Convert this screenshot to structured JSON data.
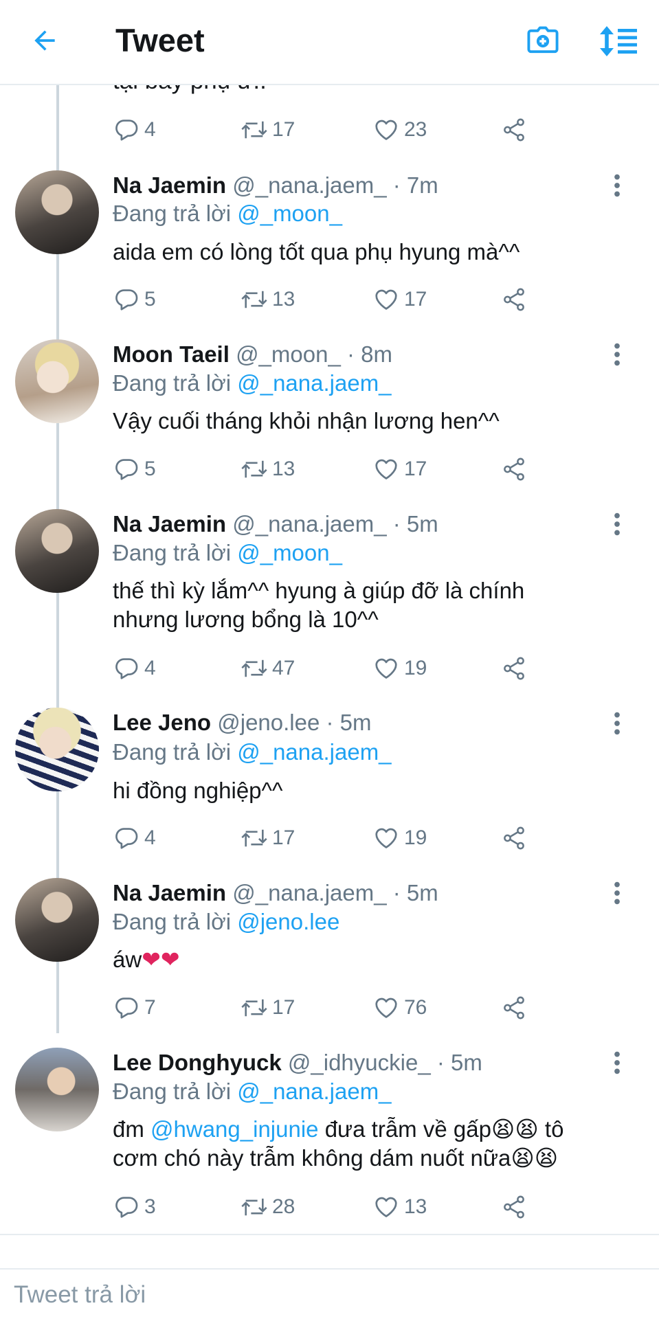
{
  "header": {
    "title": "Tweet"
  },
  "partial_tweet": {
    "text": "tại bây phụ ư..",
    "stats": {
      "replies": "4",
      "retweets": "17",
      "likes": "23"
    }
  },
  "replying_label": "Đang trả lời",
  "tweets": [
    {
      "name": "Na Jaemin",
      "handle": "@_nana.jaem_",
      "time": "· 7m",
      "replying_to": "@_moon_",
      "text": "aida em có lòng tốt qua phụ hyung mà^^",
      "stats": {
        "replies": "5",
        "retweets": "13",
        "likes": "17"
      }
    },
    {
      "name": "Moon Taeil",
      "handle": "@_moon_",
      "time": "· 8m",
      "replying_to": "@_nana.jaem_",
      "text": "Vậy cuối tháng khỏi nhận lương hen^^",
      "stats": {
        "replies": "5",
        "retweets": "13",
        "likes": "17"
      }
    },
    {
      "name": "Na Jaemin",
      "handle": "@_nana.jaem_",
      "time": "· 5m",
      "replying_to": "@_moon_",
      "text_line1": "thế thì kỳ lắm^^ hyung à giúp đỡ là chính",
      "text_line2": "nhưng lương bổng là 10^^",
      "stats": {
        "replies": "4",
        "retweets": "47",
        "likes": "19"
      }
    },
    {
      "name": "Lee Jeno",
      "handle": "@jeno.lee",
      "time": "· 5m",
      "replying_to": "@_nana.jaem_",
      "text": "hi đồng nghiệp^^",
      "stats": {
        "replies": "4",
        "retweets": "17",
        "likes": "19"
      }
    },
    {
      "name": "Na Jaemin",
      "handle": "@_nana.jaem_",
      "time": "· 5m",
      "replying_to": "@jeno.lee",
      "text": "áw",
      "emoji": "❤❤",
      "stats": {
        "replies": "7",
        "retweets": "17",
        "likes": "76"
      }
    },
    {
      "name": "Lee Donghyuck",
      "handle": "@_idhyuckie_",
      "time": "· 5m",
      "replying_to": "@_nana.jaem_",
      "text_prefix": "đm",
      "mention": "@hwang_injunie",
      "text_mid": "đưa trẫm về gấp",
      "emoji_a": "😫😫",
      "text_after": "tô",
      "text_line2": "cơm chó này trẫm không dám nuốt nữa",
      "emoji_b": "😫😫",
      "stats": {
        "replies": "3",
        "retweets": "28",
        "likes": "13"
      }
    }
  ],
  "reply_box": {
    "placeholder": "Tweet trả lời"
  },
  "colors": {
    "accent": "#1da1f2",
    "text": "#14171a",
    "secondary": "#657786",
    "divider": "#e6ecf0",
    "emoji_heart": "#e0245e"
  },
  "icons": [
    "back-arrow-icon",
    "camera-plus-icon",
    "sort-icon",
    "reply-icon",
    "retweet-icon",
    "like-icon",
    "share-icon",
    "more-vertical-icon"
  ]
}
